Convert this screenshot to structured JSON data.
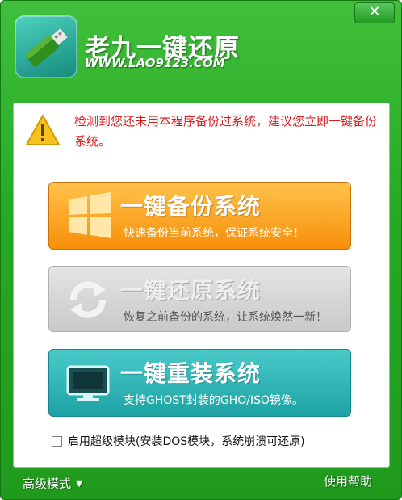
{
  "header": {
    "title": "老九一键还原",
    "website": "WWW.LAO9123.COM",
    "close_label": "✕"
  },
  "notice": {
    "text": "检测到您还未用本程序备份过系统，建议您立即一键备份系统。"
  },
  "buttons": {
    "backup": {
      "title": "一键备份系统",
      "desc": "快速备份当前系统，保证系统安全！"
    },
    "restore": {
      "title": "一键还原系统",
      "desc": "恢复之前备份的系统，让系统焕然一新！"
    },
    "reinstall": {
      "title": "一键重装系统",
      "desc": "支持GHOST封装的GHO/ISO镜像。"
    }
  },
  "option": {
    "checked": false,
    "label": "启用超级模块(安装DOS模块，系统崩溃可还原)"
  },
  "footer": {
    "advanced_label": "高级模式",
    "help_label": "使用帮助"
  },
  "colors": {
    "frame": "#27a824",
    "notice_text": "#d81c1c",
    "backup_button": "#f9a021",
    "restore_button": "#d6d6d6",
    "reinstall_button": "#2bb3b3"
  },
  "icons": {
    "logo": "usb-drive-icon",
    "warning": "warning-icon",
    "backup": "windows-logo-icon",
    "restore": "refresh-icon",
    "reinstall": "monitor-icon"
  }
}
